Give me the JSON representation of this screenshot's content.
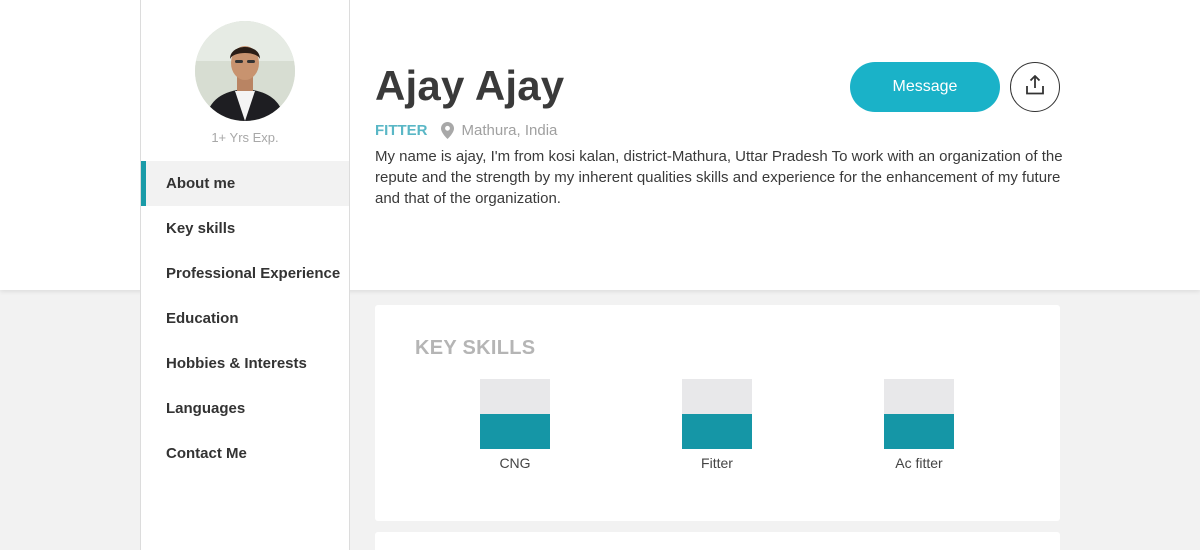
{
  "profile": {
    "name": "Ajay Ajay",
    "experience": "1+ Yrs Exp.",
    "role": "FITTER",
    "location": "Mathura, India",
    "bio": "My name is ajay, I'm from kosi kalan, district-Mathura, Uttar Pradesh To work with an organization of the repute and the strength by my inherent qualities skills and experience for the enhancement of my future and that of the organization."
  },
  "actions": {
    "message_label": "Message",
    "share_icon": "share-upload-icon"
  },
  "sidebar": {
    "items": [
      {
        "label": "About me",
        "active": true
      },
      {
        "label": "Key skills",
        "active": false
      },
      {
        "label": "Professional Experience",
        "active": false
      },
      {
        "label": "Education",
        "active": false
      },
      {
        "label": "Hobbies & Interests",
        "active": false
      },
      {
        "label": "Languages",
        "active": false
      },
      {
        "label": "Contact Me",
        "active": false
      }
    ]
  },
  "key_skills": {
    "title": "KEY SKILLS",
    "skills": [
      {
        "label": "CNG",
        "level": 0.5
      },
      {
        "label": "Fitter",
        "level": 0.5
      },
      {
        "label": "Ac fitter",
        "level": 0.5
      }
    ]
  },
  "colors": {
    "accent": "#1ab2c8",
    "skill_fill": "#1596a6",
    "skill_track": "#e8e8ea",
    "role_text": "#5ab7c6"
  }
}
